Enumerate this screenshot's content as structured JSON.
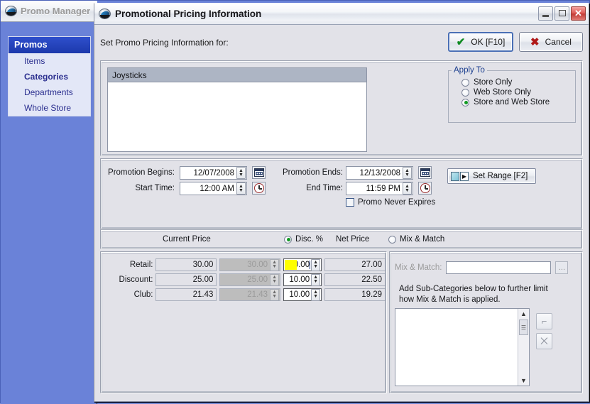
{
  "background_window": {
    "title": "Promo Manager",
    "icon": "app-logo-icon",
    "sidebar": {
      "header": "Promos",
      "items": [
        {
          "label": "Items",
          "selected": false
        },
        {
          "label": "Categories",
          "selected": true
        },
        {
          "label": "Departments",
          "selected": false
        },
        {
          "label": "Whole Store",
          "selected": false
        }
      ]
    }
  },
  "dialog": {
    "title": "Promotional Pricing Information",
    "icon": "app-logo-icon",
    "window_buttons": {
      "minimize": "minimize-icon",
      "maximize": "maximize-icon",
      "close": "✕"
    },
    "instruction": "Set Promo Pricing Information for:",
    "buttons": {
      "ok": "OK [F10]",
      "cancel": "Cancel"
    },
    "list": {
      "header": "Joysticks",
      "rows": []
    },
    "apply_to": {
      "legend": "Apply To",
      "options": [
        {
          "label": "Store Only",
          "selected": false
        },
        {
          "label": "Web Store Only",
          "selected": false
        },
        {
          "label": "Store and Web Store",
          "selected": true
        }
      ]
    },
    "schedule": {
      "begins_label": "Promotion Begins:",
      "begins_value": "12/07/2008",
      "ends_label": "Promotion Ends:",
      "ends_value": "12/13/2008",
      "start_time_label": "Start Time:",
      "start_time_value": "12:00 AM",
      "end_time_label": "End Time:",
      "end_time_value": "11:59 PM",
      "never_expires_label": "Promo Never Expires",
      "never_expires_checked": false,
      "set_range_button": "Set Range [F2]",
      "set_range_accelerator": "S"
    },
    "pricing_mode": {
      "current_price_label": "Current Price",
      "net_price_label": "Net Price",
      "options": [
        {
          "label": "Disc. %",
          "selected": true
        },
        {
          "label": "Mix & Match",
          "selected": false
        }
      ]
    },
    "price_table": {
      "rows": [
        {
          "label": "Retail:",
          "current": "30.00",
          "disabled": "30.00",
          "percent": "10.00",
          "net": "27.00",
          "focused": true
        },
        {
          "label": "Discount:",
          "current": "25.00",
          "disabled": "25.00",
          "percent": "10.00",
          "net": "22.50",
          "focused": false
        },
        {
          "label": "Club:",
          "current": "21.43",
          "disabled": "21.43",
          "percent": "10.00",
          "net": "19.29",
          "focused": false
        }
      ]
    },
    "mix_match": {
      "label": "Mix & Match:",
      "value": "",
      "browse_button": "...",
      "help_text": "Add Sub-Categories below to further limit how Mix & Match is applied.",
      "sub_categories": [],
      "side_buttons": [
        {
          "name": "add-subcategory-button",
          "glyph": "⌐"
        },
        {
          "name": "delete-subcategory-button",
          "glyph": "⨉"
        }
      ],
      "scrollbar": {
        "up": "▲",
        "down": "▼"
      }
    }
  },
  "colors": {
    "sidebar_blue": "#6a82d8",
    "sidebar_header": "#2342c0",
    "dialog_face": "#e2e2e8",
    "list_header": "#adb5c4",
    "focus_highlight": "#ffff00",
    "ok_check": "#0f8a22",
    "cancel_x": "#b01818",
    "radio_dot": "#119a22"
  }
}
